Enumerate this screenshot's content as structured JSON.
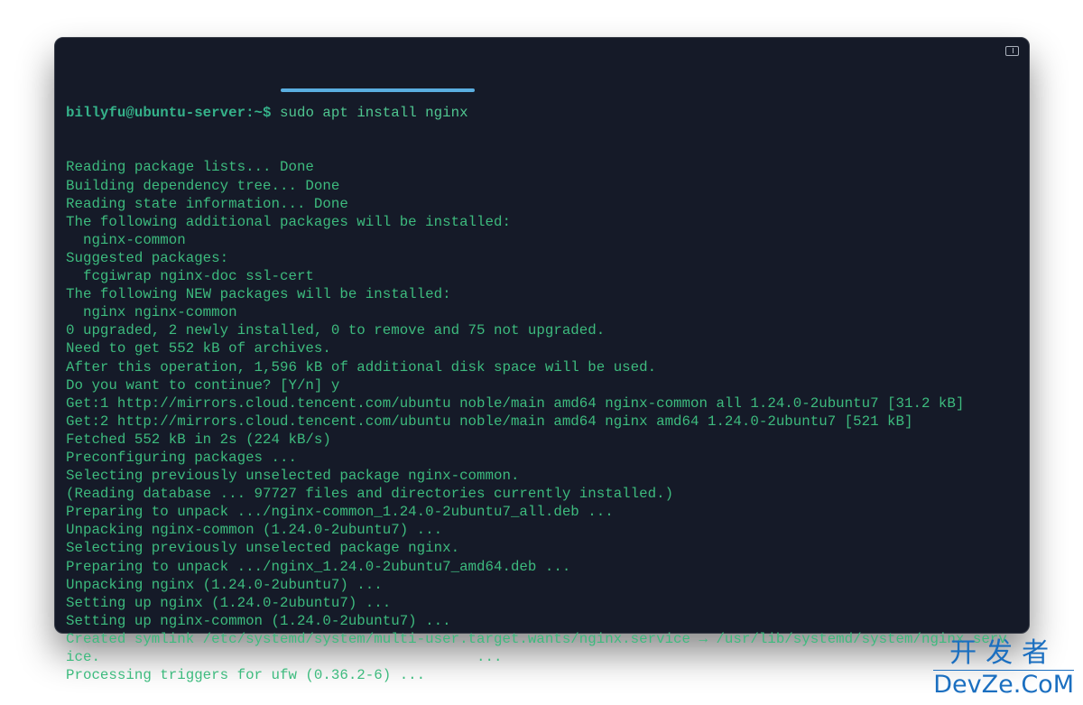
{
  "terminal": {
    "prompt": "billyfu@ubuntu-server:~$ ",
    "command": "sudo apt install nginx",
    "output": [
      "Reading package lists... Done",
      "Building dependency tree... Done",
      "Reading state information... Done",
      "The following additional packages will be installed:",
      "  nginx-common",
      "Suggested packages:",
      "  fcgiwrap nginx-doc ssl-cert",
      "The following NEW packages will be installed:",
      "  nginx nginx-common",
      "0 upgraded, 2 newly installed, 0 to remove and 75 not upgraded.",
      "Need to get 552 kB of archives.",
      "After this operation, 1,596 kB of additional disk space will be used.",
      "Do you want to continue? [Y/n] y",
      "Get:1 http://mirrors.cloud.tencent.com/ubuntu noble/main amd64 nginx-common all 1.24.0-2ubuntu7 [31.2 kB]",
      "Get:2 http://mirrors.cloud.tencent.com/ubuntu noble/main amd64 nginx amd64 1.24.0-2ubuntu7 [521 kB]",
      "Fetched 552 kB in 2s (224 kB/s)",
      "Preconfiguring packages ...",
      "Selecting previously unselected package nginx-common.",
      "(Reading database ... 97727 files and directories currently installed.)",
      "Preparing to unpack .../nginx-common_1.24.0-2ubuntu7_all.deb ...",
      "Unpacking nginx-common (1.24.0-2ubuntu7) ...",
      "Selecting previously unselected package nginx.",
      "Preparing to unpack .../nginx_1.24.0-2ubuntu7_amd64.deb ...",
      "Unpacking nginx (1.24.0-2ubuntu7) ...",
      "Setting up nginx (1.24.0-2ubuntu7) ...",
      "Setting up nginx-common (1.24.0-2ubuntu7) ...",
      "Created symlink /etc/systemd/system/multi-user.target.wants/nginx.service → /usr/lib/systemd/system/nginx.serv",
      "ice.                                            ...",
      "Processing triggers for ufw (0.36.2-6) ..."
    ]
  },
  "icons": {
    "panel_toggle": "sidebar-toggle-icon"
  },
  "watermark": {
    "cn": "开发者",
    "en": "DevZe.CoM"
  },
  "colors": {
    "background": "#151a28",
    "text": "#3dbb7e",
    "underline": "#5aaee0",
    "watermark": "#1b6fc0"
  }
}
